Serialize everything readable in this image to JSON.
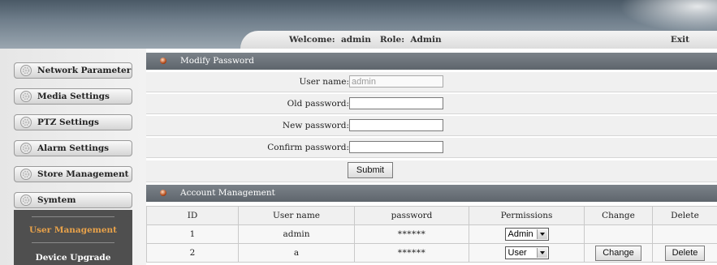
{
  "header": {
    "welcome_text": "Welcome:  admin   Role:  Admin",
    "exit_label": "Exit"
  },
  "sidebar": {
    "items": [
      {
        "label": "Network Parameter",
        "icon": "gear-icon"
      },
      {
        "label": "Media Settings",
        "icon": "gear-icon"
      },
      {
        "label": "PTZ Settings",
        "icon": "gear-icon"
      },
      {
        "label": "Alarm Settings",
        "icon": "gear-icon"
      },
      {
        "label": "Store Management",
        "icon": "gear-icon"
      },
      {
        "label": "Symtem",
        "icon": "gear-icon"
      }
    ],
    "submenu": [
      {
        "label": "User Management",
        "active": true,
        "color": "#e8a24a"
      },
      {
        "label": "Device Upgrade",
        "active": false,
        "color": "#ffffff"
      }
    ]
  },
  "modify_password": {
    "title": "Modify Password",
    "user_name_label": "User name:",
    "user_name_value": "admin",
    "old_password_label": "Old password:",
    "new_password_label": "New password:",
    "confirm_password_label": "Confirm password:",
    "submit_label": "Submit"
  },
  "account_management": {
    "title": "Account Management",
    "columns": [
      "ID",
      "User name",
      "password",
      "Permissions",
      "Change",
      "Delete"
    ],
    "rows": [
      {
        "id": "1",
        "user_name": "admin",
        "password": "******",
        "permission": "Admin",
        "change_label": "",
        "delete_label": ""
      },
      {
        "id": "2",
        "user_name": "a",
        "password": "******",
        "permission": "User",
        "change_label": "Change",
        "delete_label": "Delete"
      }
    ]
  },
  "colors": {
    "header_dark": "#4a5966",
    "section_header": "#6b7279",
    "submenu_bg": "#4f4f4f",
    "active_submenu": "#e8a24a"
  }
}
